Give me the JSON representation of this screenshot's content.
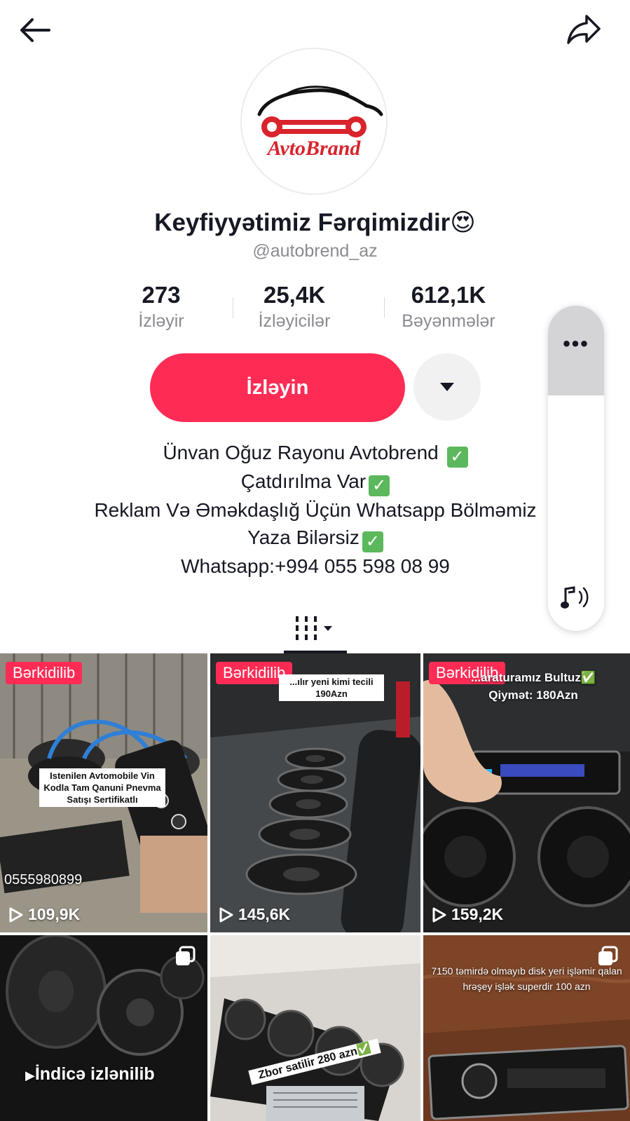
{
  "header": {
    "back_icon": "arrow-left-icon",
    "share_icon": "share-arrow-icon"
  },
  "profile": {
    "avatar_logo_text": "AvtoBrand",
    "display_name": "Keyfiyyətimiz Fərqimizdir😍",
    "username": "@autobrend_az"
  },
  "stats": {
    "following_value": "273",
    "following_label": "İzləyir",
    "followers_value": "25,4K",
    "followers_label": "İzləyicilər",
    "likes_value": "612,1K",
    "likes_label": "Bəyənmələr"
  },
  "actions": {
    "follow_label": "İzləyin",
    "dropdown_icon": "caret-down-icon"
  },
  "bio": {
    "line1": "Ünvan Oğuz Rayonu Avtobrend",
    "line2": "Çatdırılma Var",
    "line3": "Reklam Və Əməkdaşlığ Üçün Whatsapp Bölməmiz",
    "line4": "Yaza Bilərsiz",
    "line5": "Whatsapp:+994 055 598 08 99",
    "check_icon": "check-mark-icon"
  },
  "side_panel": {
    "more_label": "•••",
    "sound_icon": "music-note-sound-icon"
  },
  "tabs": {
    "videos_icon": "grid-bars-icon"
  },
  "videos": [
    {
      "pinned_label": "Bərkidilib",
      "caption": "Istenilen Avtomobile Vin Kodla Tam Qanuni Pnevma Satışı Sertifikatlı",
      "overlay": "0555980899",
      "views": "109,9K"
    },
    {
      "pinned_label": "Bərkidilib",
      "caption": "...ılır yeni kimi tecili 190Azn",
      "views": "145,6K"
    },
    {
      "pinned_label": "Bərkidilib",
      "caption": "...araturamız Bultuz✅ Qiymət: 180Azn",
      "views": "159,2K"
    },
    {
      "overlay": "İndicə izlənilib"
    },
    {
      "caption": "Zbor satilir 280 azn✅"
    },
    {
      "caption": "7150 təmirdə olmayıb disk yeri işləmir qalan hrəşey işlək superdir 100 azn"
    }
  ],
  "colors": {
    "accent": "#fe2c55",
    "text": "#161823",
    "muted": "#8a8b91"
  }
}
